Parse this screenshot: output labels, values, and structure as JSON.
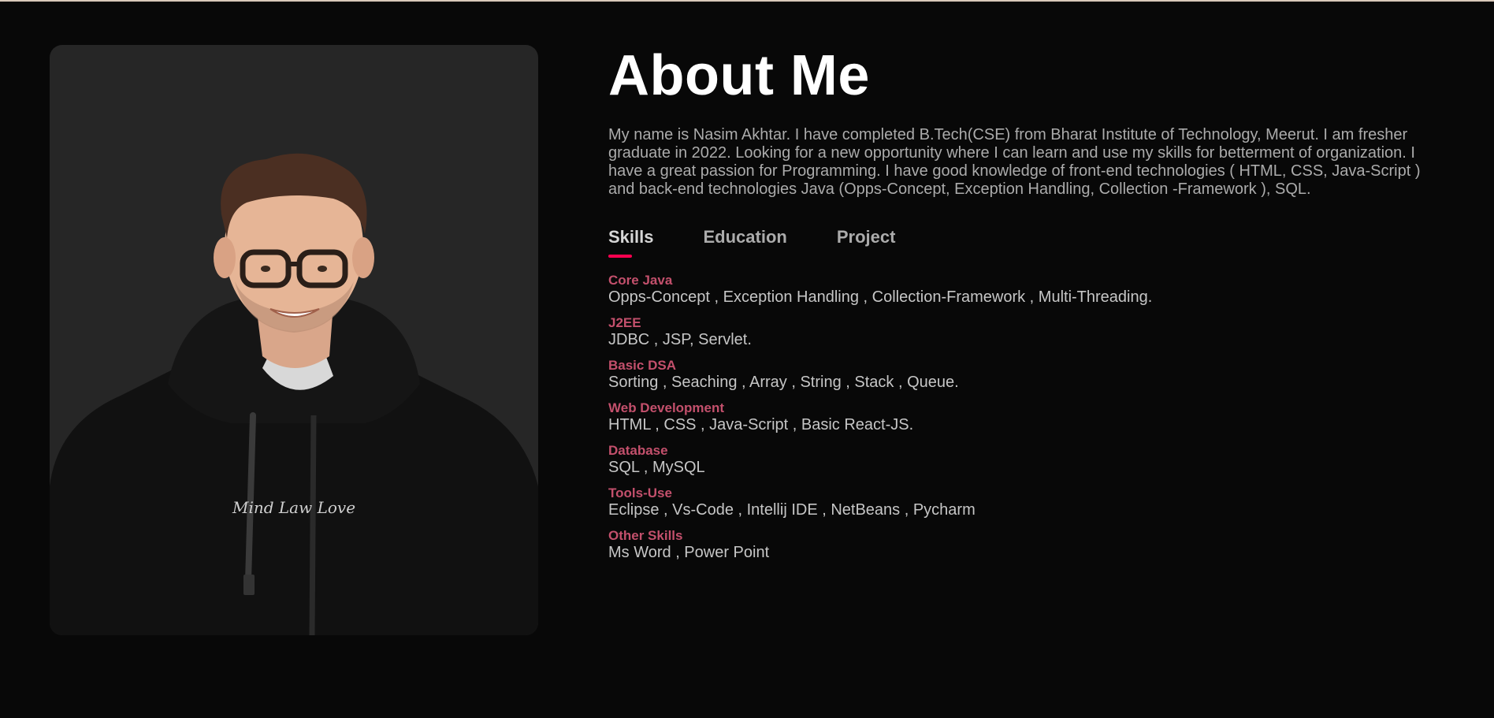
{
  "header": {
    "title": "About Me"
  },
  "intro": {
    "text": "My name is Nasim Akhtar. I have completed B.Tech(CSE) from Bharat Institute of Technology, Meerut. I am fresher graduate in 2022. Looking for a new opportunity where I can learn and use my skills for betterment of organization. I have a great passion for Programming. I have good knowledge of front-end technologies ( HTML, CSS, Java-Script ) and back-end technologies Java (Opps-Concept, Exception Handling, Collection -Framework ), SQL."
  },
  "tabs": [
    {
      "label": "Skills",
      "active": true
    },
    {
      "label": "Education",
      "active": false
    },
    {
      "label": "Project",
      "active": false
    }
  ],
  "skills": [
    {
      "name": "Core Java",
      "detail": "Opps-Concept , Exception Handling , Collection-Framework , Multi-Threading."
    },
    {
      "name": "J2EE",
      "detail": "JDBC , JSP, Servlet."
    },
    {
      "name": "Basic DSA",
      "detail": "Sorting , Seaching , Array , String , Stack , Queue."
    },
    {
      "name": "Web Development",
      "detail": "HTML , CSS , Java-Script , Basic React-JS."
    },
    {
      "name": "Database",
      "detail": "SQL , MySQL"
    },
    {
      "name": "Tools-Use",
      "detail": "Eclipse , Vs-Code , Intellij IDE , NetBeans , Pycharm"
    },
    {
      "name": "Other Skills",
      "detail": "Ms Word , Power Point"
    }
  ],
  "profile_photo": {
    "hoodie_print": "Mind Law Love"
  },
  "colors": {
    "background": "#080808",
    "accent": "#ff004f",
    "skill_heading": "#c3506c",
    "body_text": "#ababab",
    "card": "#262626"
  }
}
